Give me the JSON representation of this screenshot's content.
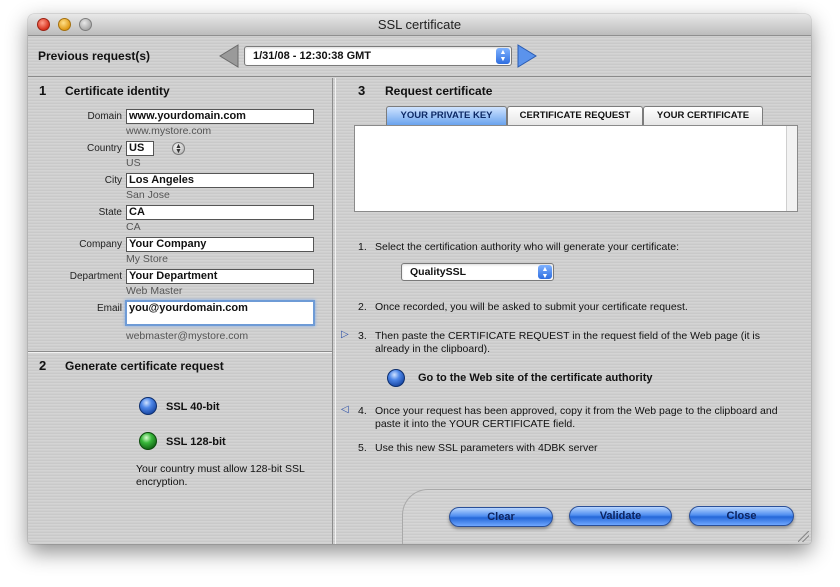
{
  "window": {
    "title": "SSL certificate"
  },
  "previous": {
    "label": "Previous request(s)",
    "selected": "1/31/08 - 12:30:38 GMT"
  },
  "identity": {
    "number": "1",
    "title": "Certificate identity",
    "fields": [
      {
        "label": "Domain",
        "value": "www.yourdomain.com",
        "hint": "www.mystore.com"
      },
      {
        "label": "Country",
        "value": "US",
        "hint": "US"
      },
      {
        "label": "City",
        "value": "Los Angeles",
        "hint": "San Jose"
      },
      {
        "label": "State",
        "value": "CA",
        "hint": "CA"
      },
      {
        "label": "Company",
        "value": "Your Company",
        "hint": "My Store"
      },
      {
        "label": "Department",
        "value": "Your Department",
        "hint": "Web Master"
      },
      {
        "label": "Email",
        "value": "you@yourdomain.com",
        "hint": "webmaster@mystore.com"
      }
    ]
  },
  "generate": {
    "number": "2",
    "title": "Generate certificate request",
    "option_40": "SSL 40-bit",
    "option_128": "SSL 128-bit",
    "note": "Your country must allow 128-bit SSL encryption."
  },
  "request": {
    "number": "3",
    "title": "Request certificate",
    "tabs": [
      "YOUR PRIVATE KEY",
      "CERTIFICATE REQUEST",
      "YOUR CERTIFICATE"
    ],
    "active_tab": 0,
    "steps": [
      {
        "n": "1.",
        "text": "Select the certification authority who will generate your certificate:"
      },
      {
        "n": "2.",
        "text": "Once recorded, you will be asked to submit your certificate request."
      },
      {
        "n": "3.",
        "text": "Then paste the CERTIFICATE REQUEST in the request field of the Web page (it is already in the clipboard)."
      },
      {
        "n": "4.",
        "text": "Once your request has been approved, copy it from the Web page to the clipboard and paste it into the YOUR CERTIFICATE field."
      },
      {
        "n": "5.",
        "text": "Use this new SSL parameters with 4DBK server"
      }
    ],
    "authority": "QualitySSL",
    "go_link": "Go to the Web site of the certificate authority"
  },
  "buttons": {
    "clear": "Clear",
    "validate": "Validate",
    "close": "Close"
  },
  "colors": {
    "accent": "#2567d8",
    "tab_active": "#6aa3ee"
  }
}
